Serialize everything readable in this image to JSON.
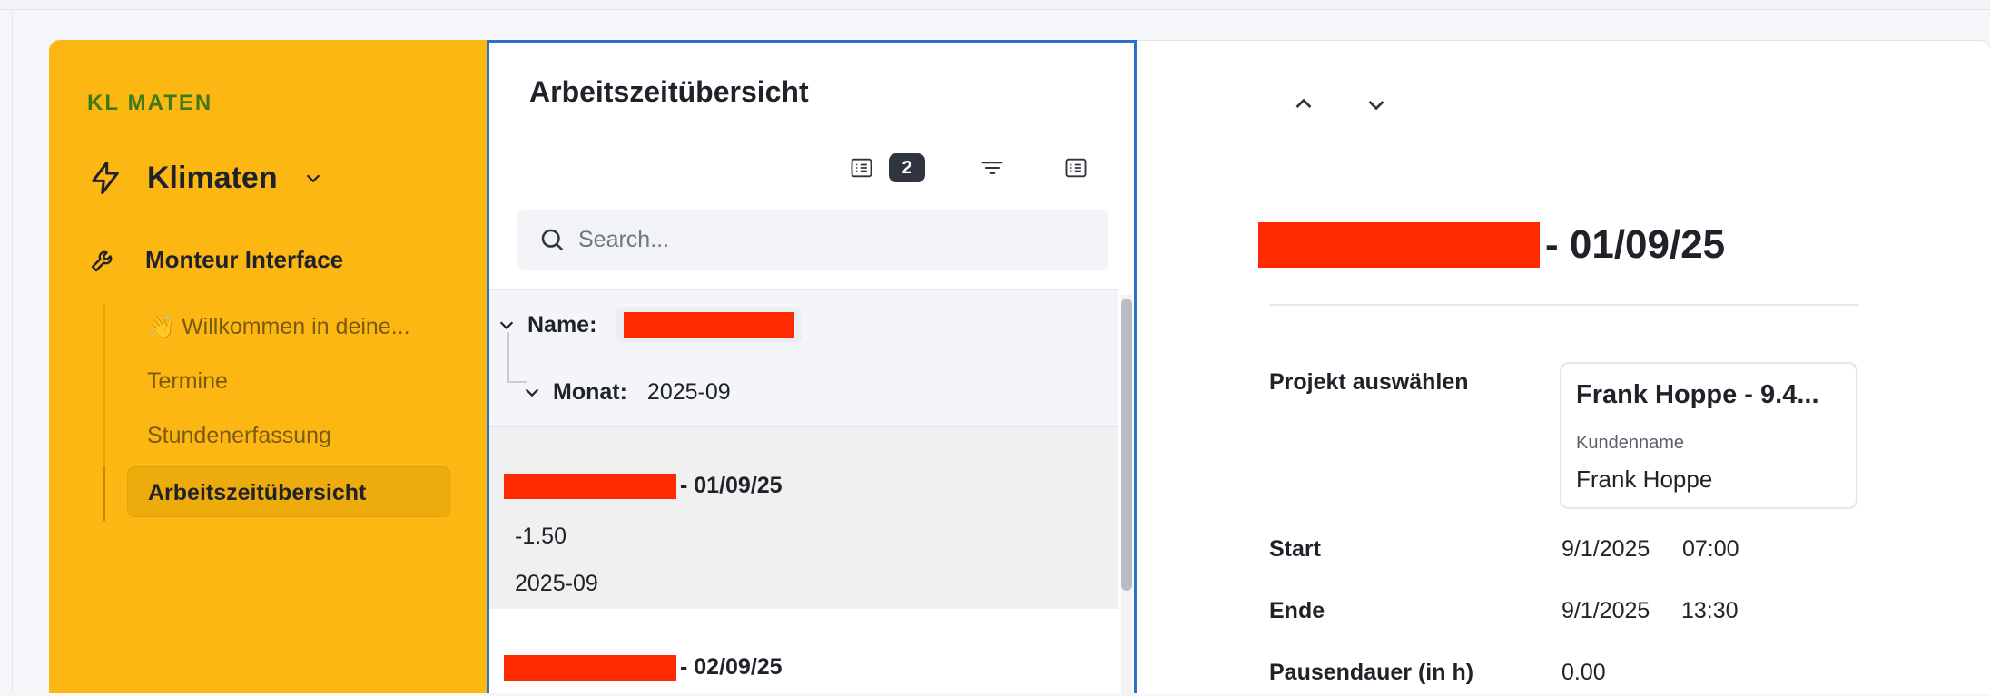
{
  "sidebar": {
    "brand": {
      "part1": "KL",
      "slash": "/",
      "part2": "MATEN"
    },
    "app_name": "Klimaten",
    "group_label": "Monteur Interface",
    "items": [
      {
        "label": "👋 Willkommen in deine..."
      },
      {
        "label": "Termine"
      },
      {
        "label": "Stundenerfassung"
      },
      {
        "label": "Arbeitszeitübersicht",
        "active": true
      }
    ]
  },
  "list": {
    "title": "Arbeitszeitübersicht",
    "group_count": "2",
    "search_placeholder": "Search...",
    "group_name_key": "Name:",
    "group_month_key": "Monat:",
    "group_month_value": "2025-09",
    "items": [
      {
        "date_suffix": "- 01/09/25",
        "hours": "-1.50",
        "month": "2025-09"
      },
      {
        "date_suffix": "- 02/09/25"
      }
    ]
  },
  "detail": {
    "title_suffix": "- 01/09/25",
    "fields": {
      "project_label": "Projekt auswählen",
      "project_title": "Frank Hoppe - 9.4...",
      "customer_label": "Kundenname",
      "customer_name": "Frank Hoppe",
      "start_label": "Start",
      "start_date": "9/1/2025",
      "start_time": "07:00",
      "end_label": "Ende",
      "end_date": "9/1/2025",
      "end_time": "13:30",
      "pause_label": "Pausendauer (in h)",
      "pause_value": "0.00"
    }
  },
  "colors": {
    "sidebar": "#fdb713",
    "redaction": "#ff2a00",
    "focus_border": "#2b70c9"
  }
}
